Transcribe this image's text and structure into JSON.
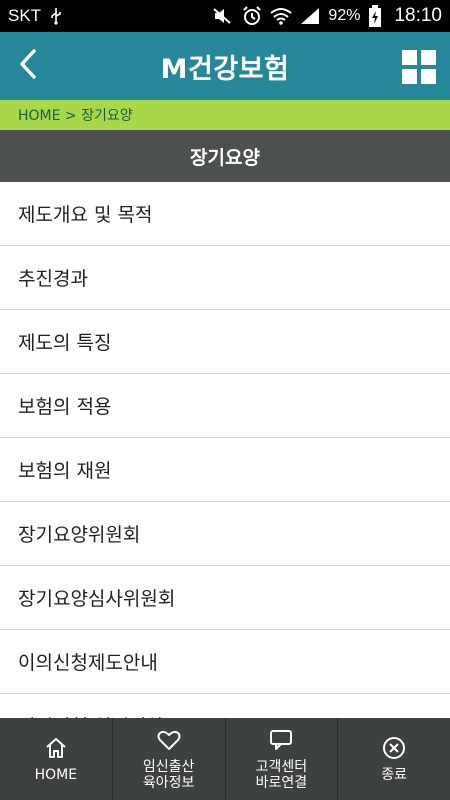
{
  "status_bar": {
    "carrier": "SKT",
    "battery_percent": "92%",
    "time": "18:10",
    "icons": [
      "usb-icon",
      "mute-icon",
      "alarm-icon",
      "wifi-icon",
      "signal-icon",
      "battery-charging-icon"
    ]
  },
  "header": {
    "title": "M건강보험",
    "back_icon": "chevron-left-icon",
    "menu_icon": "grid-menu-icon"
  },
  "breadcrumb": "HOME > 장기요양",
  "section_title": "장기요양",
  "menu_items": [
    "제도개요 및 목적",
    "추진경과",
    "제도의 특징",
    "보험의 적용",
    "보험의 재원",
    "장기요양위원회",
    "장기요양심사위원회",
    "이의신청제도안내",
    "이의신청 처리절차"
  ],
  "bottom_nav": [
    {
      "label": "HOME",
      "icon": "home-icon"
    },
    {
      "label": "임신출산\n육아정보",
      "icon": "heart-icon"
    },
    {
      "label": "고객센터\n바로연결",
      "icon": "chat-icon"
    },
    {
      "label": "종료",
      "icon": "close-circle-icon"
    }
  ],
  "colors": {
    "header_bg": "#26879a",
    "breadcrumb_bg": "#a6d84a",
    "section_bg": "#4c5150",
    "bottom_nav_bg": "#3d4142"
  }
}
